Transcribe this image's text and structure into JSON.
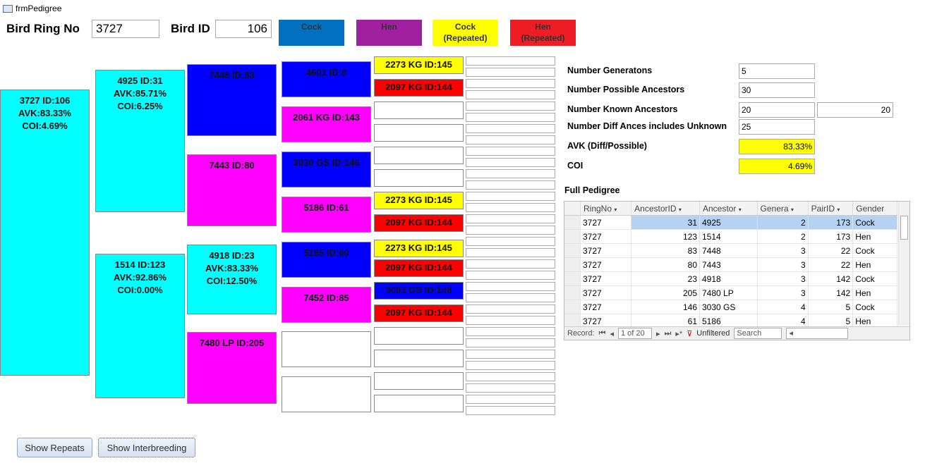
{
  "window": {
    "title": "frmPedigree",
    "icon": "form-icon"
  },
  "header": {
    "ring_label": "Bird Ring No",
    "ring_value": "3727",
    "id_label": "Bird ID",
    "id_value": "106"
  },
  "legend": [
    {
      "label": "Cock",
      "color": "#0070c0"
    },
    {
      "label": "Hen",
      "color": "#a020a0"
    },
    {
      "label": "Cock\n(Repeated)",
      "color": "#ffff00"
    },
    {
      "label": "Hen\n(Repeated)",
      "color": "#ee1c24"
    }
  ],
  "colors": {
    "subject": "#00ffff",
    "cock": "#0000ff",
    "hen": "#ff00ff",
    "cock_repeated": "#ffff00",
    "hen_repeated": "#ff0000"
  },
  "gen1": [
    {
      "text": "3727 ID:106\nAVK:83.33%\nCOI:4.69%",
      "color": "#00ffff"
    }
  ],
  "gen2": [
    {
      "text": "4925 ID:31\nAVK:85.71%\nCOI:6.25%",
      "color": "#00ffff"
    },
    {
      "text": "1514 ID:123\nAVK:92.86%\nCOI:0.00%",
      "color": "#00ffff"
    }
  ],
  "gen3": [
    {
      "text": "7448 ID:83",
      "color": "#0000ff"
    },
    {
      "text": "7443 ID:80",
      "color": "#ff00ff"
    },
    {
      "text": "4918 ID:23\nAVK:83.33%\nCOI:12.50%",
      "color": "#00ffff"
    },
    {
      "text": "7480 LP ID:205",
      "color": "#ff00ff"
    }
  ],
  "gen4": [
    {
      "text": "4601 ID:8",
      "color": "#0000ff"
    },
    {
      "text": "2061 KG ID:143",
      "color": "#ff00ff"
    },
    {
      "text": "3030 GS ID:146",
      "color": "#0000ff"
    },
    {
      "text": "5186 ID:61",
      "color": "#ff00ff"
    },
    {
      "text": "5185 ID:60",
      "color": "#0000ff"
    },
    {
      "text": "7452 ID:85",
      "color": "#ff00ff"
    },
    {
      "text": "",
      "color": "#ffffff"
    },
    {
      "text": "",
      "color": "#ffffff"
    }
  ],
  "gen5": [
    {
      "text": "2273 KG ID:145",
      "color": "#ffff00"
    },
    {
      "text": "2097 KG ID:144",
      "color": "#ff0000"
    },
    {
      "text": "",
      "color": "#ffffff"
    },
    {
      "text": "",
      "color": "#ffffff"
    },
    {
      "text": "",
      "color": "#ffffff"
    },
    {
      "text": "",
      "color": "#ffffff"
    },
    {
      "text": "2273 KG ID:145",
      "color": "#ffff00"
    },
    {
      "text": "2097 KG ID:144",
      "color": "#ff0000"
    },
    {
      "text": "2273 KG ID:145",
      "color": "#ffff00"
    },
    {
      "text": "2097 KG ID:144",
      "color": "#ff0000"
    },
    {
      "text": "3053 GS ID:148",
      "color": "#0000ff"
    },
    {
      "text": "2097 KG ID:144",
      "color": "#ff0000"
    },
    {
      "text": "",
      "color": "#ffffff"
    },
    {
      "text": "",
      "color": "#ffffff"
    },
    {
      "text": "",
      "color": "#ffffff"
    },
    {
      "text": "",
      "color": "#ffffff"
    }
  ],
  "stats": [
    {
      "label": "Number Generatons",
      "value": "5"
    },
    {
      "label": "Number Possible Ancestors",
      "value": "30"
    },
    {
      "label": "Number Known Ancestors",
      "value": "20",
      "value2": "20"
    },
    {
      "label": "Number  Diff Ances includes Unknown",
      "value": "25"
    },
    {
      "label": "AVK (Diff/Possible)",
      "value": "83.33%"
    },
    {
      "label": "COI",
      "value": "4.69%"
    }
  ],
  "grid": {
    "title": "Full Pedigree",
    "columns": [
      "RingNo",
      "AncestorID",
      "Ancestor",
      "Genera",
      "PairID",
      "Gender"
    ],
    "rows": [
      [
        "3727",
        "31",
        "4925",
        "2",
        "173",
        "Cock"
      ],
      [
        "3727",
        "123",
        "1514",
        "2",
        "173",
        "Hen"
      ],
      [
        "3727",
        "83",
        "7448",
        "3",
        "22",
        "Cock"
      ],
      [
        "3727",
        "80",
        "7443",
        "3",
        "22",
        "Hen"
      ],
      [
        "3727",
        "23",
        "4918",
        "3",
        "142",
        "Cock"
      ],
      [
        "3727",
        "205",
        "7480 LP",
        "3",
        "142",
        "Hen"
      ],
      [
        "3727",
        "146",
        "3030 GS",
        "4",
        "5",
        "Cock"
      ],
      [
        "3727",
        "61",
        "5186",
        "4",
        "5",
        "Hen"
      ]
    ],
    "nav": {
      "record_label": "Record:",
      "position": "1 of 20",
      "filter": "Unfiltered",
      "search": "Search"
    }
  },
  "buttons": {
    "show_repeats": "Show Repeats",
    "show_interbreeding": "Show Interbreeding"
  }
}
